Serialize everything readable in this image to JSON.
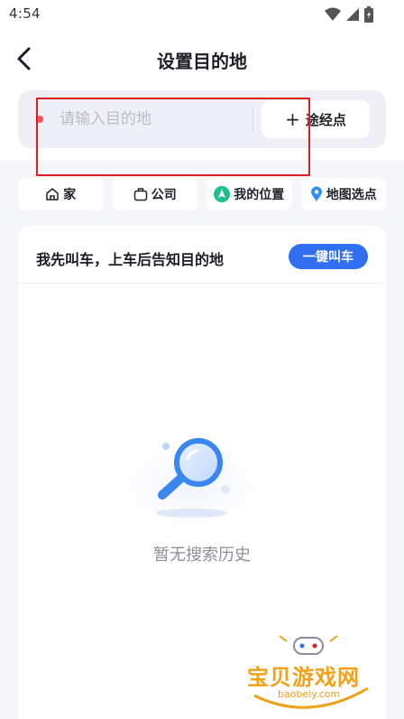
{
  "status_bar": {
    "time": "4:54"
  },
  "header": {
    "title": "设置目的地"
  },
  "search": {
    "placeholder": "请输入目的地",
    "value": "",
    "waypoint_plus": "+",
    "waypoint_label": "途经点"
  },
  "chips": [
    {
      "label": "家",
      "icon": "home-icon"
    },
    {
      "label": "公司",
      "icon": "briefcase-icon"
    },
    {
      "label": "我的位置",
      "icon": "location-arrow-icon"
    },
    {
      "label": "地图选点",
      "icon": "map-pin-icon"
    }
  ],
  "history": {
    "prompt": "我先叫车，上车后告知目的地",
    "call_button": "一键叫车",
    "empty_text": "暂无搜索历史"
  },
  "watermark": {
    "text": "宝贝游戏网",
    "url": "baobeiy.com"
  },
  "colors": {
    "accent": "#2f6ff0",
    "destination_dot": "#ff4f58",
    "location_chip": "#1fbf8f",
    "map_pin": "#2f8cf0",
    "highlight": "#e01b24",
    "background": "#f4f6fa"
  }
}
